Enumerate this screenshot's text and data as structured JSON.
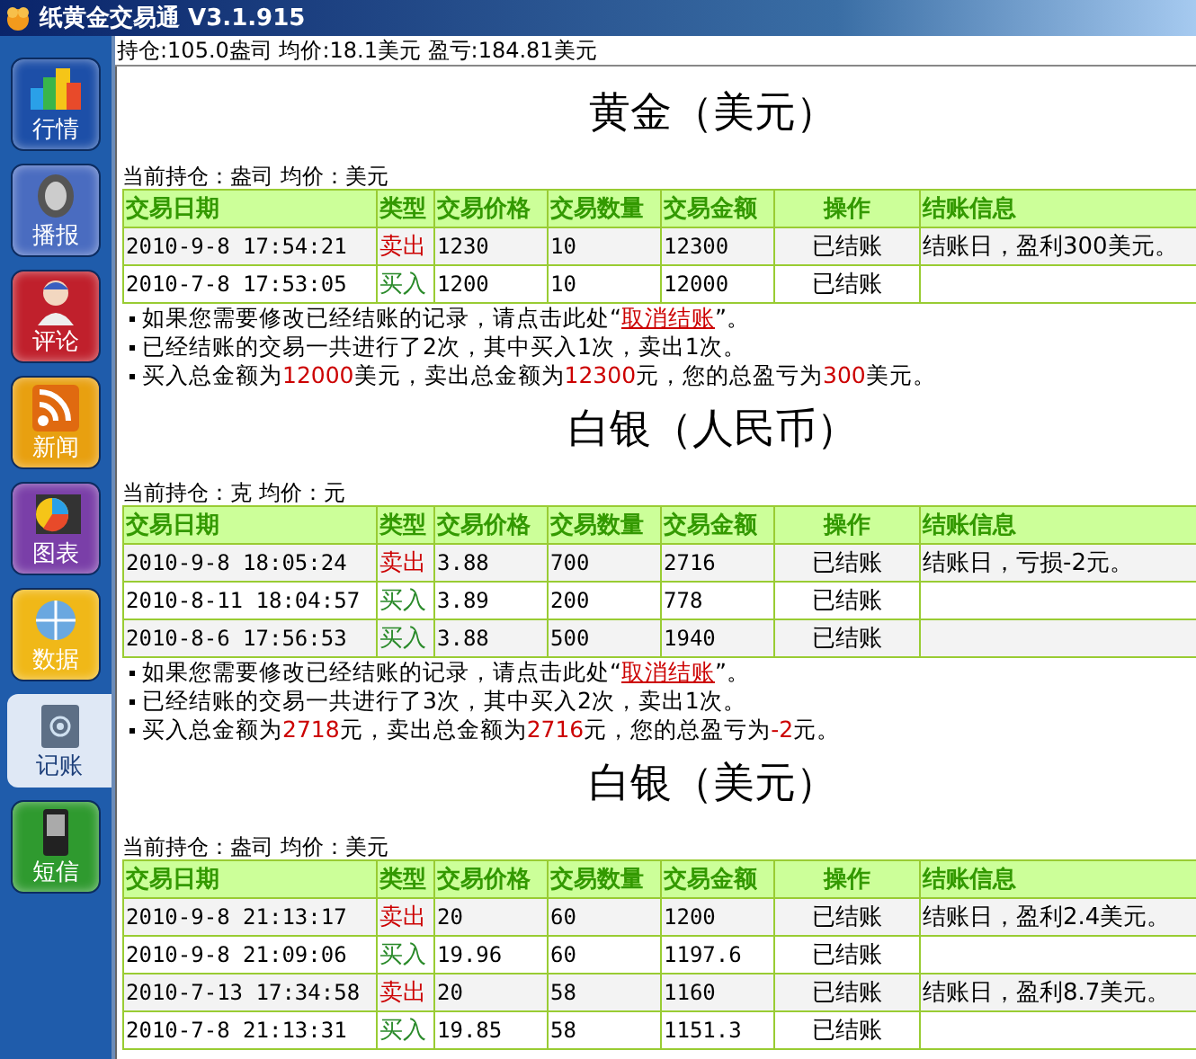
{
  "window": {
    "title": "纸黄金交易通 V3.1.915"
  },
  "sidebar": {
    "items": [
      {
        "label": "行情",
        "selected": false
      },
      {
        "label": "播报",
        "selected": false
      },
      {
        "label": "评论",
        "selected": false
      },
      {
        "label": "新闻",
        "selected": false
      },
      {
        "label": "图表",
        "selected": false
      },
      {
        "label": "数据",
        "selected": false
      },
      {
        "label": "记账",
        "selected": true
      },
      {
        "label": "短信",
        "selected": false
      }
    ]
  },
  "status_line": "持仓:105.0盎司 均价:18.1美元 盈亏:184.81美元",
  "sections": [
    {
      "title": "黄金（美元）",
      "position": "当前持仓：盎司  均价：美元",
      "columns": [
        "交易日期",
        "类型",
        "交易价格",
        "交易数量",
        "交易金额",
        "操作",
        "结账信息"
      ],
      "rows": [
        {
          "date": "2010-9-8 17:54:21",
          "type": "卖出",
          "kind": "sell",
          "price": "1230",
          "qty": "10",
          "amount": "12300",
          "op": "已结账",
          "info": "结账日，盈利300美元。"
        },
        {
          "date": "2010-7-8 17:53:05",
          "type": "买入",
          "kind": "buy",
          "price": "1200",
          "qty": "10",
          "amount": "12000",
          "op": "已结账"
        }
      ],
      "notes": [
        [
          {
            "text": "如果您需要修改已经结账的记录，请点击此处“",
            "kind": "text"
          },
          {
            "text": "取消结账",
            "kind": "link"
          },
          {
            "text": "”。",
            "kind": "text"
          }
        ],
        [
          {
            "text": "已经结账的交易一共进行了2次，其中买入1次，卖出1次。",
            "kind": "text"
          }
        ],
        [
          {
            "text": "买入总金额为",
            "kind": "text"
          },
          {
            "text": "12000",
            "kind": "amount"
          },
          {
            "text": "美元，卖出总金额为",
            "kind": "text"
          },
          {
            "text": "12300",
            "kind": "amount"
          },
          {
            "text": "元，您的总盈亏为",
            "kind": "text"
          },
          {
            "text": "300",
            "kind": "amount"
          },
          {
            "text": "美元。",
            "kind": "text"
          }
        ]
      ]
    },
    {
      "title": "白银（人民币）",
      "position": "当前持仓：克  均价：元",
      "columns": [
        "交易日期",
        "类型",
        "交易价格",
        "交易数量",
        "交易金额",
        "操作",
        "结账信息"
      ],
      "rows": [
        {
          "date": "2010-9-8 18:05:24",
          "type": "卖出",
          "kind": "sell",
          "price": "3.88",
          "qty": "700",
          "amount": "2716",
          "op": "已结账",
          "info": "结账日，亏损-2元。"
        },
        {
          "date": "2010-8-11 18:04:57",
          "type": "买入",
          "kind": "buy",
          "price": "3.89",
          "qty": "200",
          "amount": "778",
          "op": "已结账"
        },
        {
          "date": "2010-8-6 17:56:53",
          "type": "买入",
          "kind": "buy",
          "price": "3.88",
          "qty": "500",
          "amount": "1940",
          "op": "已结账"
        }
      ],
      "notes": [
        [
          {
            "text": "如果您需要修改已经结账的记录，请点击此处“",
            "kind": "text"
          },
          {
            "text": "取消结账",
            "kind": "link"
          },
          {
            "text": "”。",
            "kind": "text"
          }
        ],
        [
          {
            "text": "已经结账的交易一共进行了3次，其中买入2次，卖出1次。",
            "kind": "text"
          }
        ],
        [
          {
            "text": "买入总金额为",
            "kind": "text"
          },
          {
            "text": "2718",
            "kind": "amount"
          },
          {
            "text": "元，卖出总金额为",
            "kind": "text"
          },
          {
            "text": "2716",
            "kind": "amount"
          },
          {
            "text": "元，您的总盈亏为",
            "kind": "text"
          },
          {
            "text": "-2",
            "kind": "amount"
          },
          {
            "text": "元。",
            "kind": "text"
          }
        ]
      ]
    },
    {
      "title": "白银（美元）",
      "position": "当前持仓：盎司  均价：美元",
      "columns": [
        "交易日期",
        "类型",
        "交易价格",
        "交易数量",
        "交易金额",
        "操作",
        "结账信息"
      ],
      "rows": [
        {
          "date": "2010-9-8 21:13:17",
          "type": "卖出",
          "kind": "sell",
          "price": "20",
          "qty": "60",
          "amount": "1200",
          "op": "已结账",
          "info": "结账日，盈利2.4美元。"
        },
        {
          "date": "2010-9-8 21:09:06",
          "type": "买入",
          "kind": "buy",
          "price": "19.96",
          "qty": "60",
          "amount": "1197.6",
          "op": "已结账"
        },
        {
          "date": "2010-7-13 17:34:58",
          "type": "卖出",
          "kind": "sell",
          "price": "20",
          "qty": "58",
          "amount": "1160",
          "op": "已结账",
          "info": "结账日，盈利8.7美元。"
        },
        {
          "date": "2010-7-8 21:13:31",
          "type": "买入",
          "kind": "buy",
          "price": "19.85",
          "qty": "58",
          "amount": "1151.3",
          "op": "已结账"
        }
      ]
    }
  ]
}
